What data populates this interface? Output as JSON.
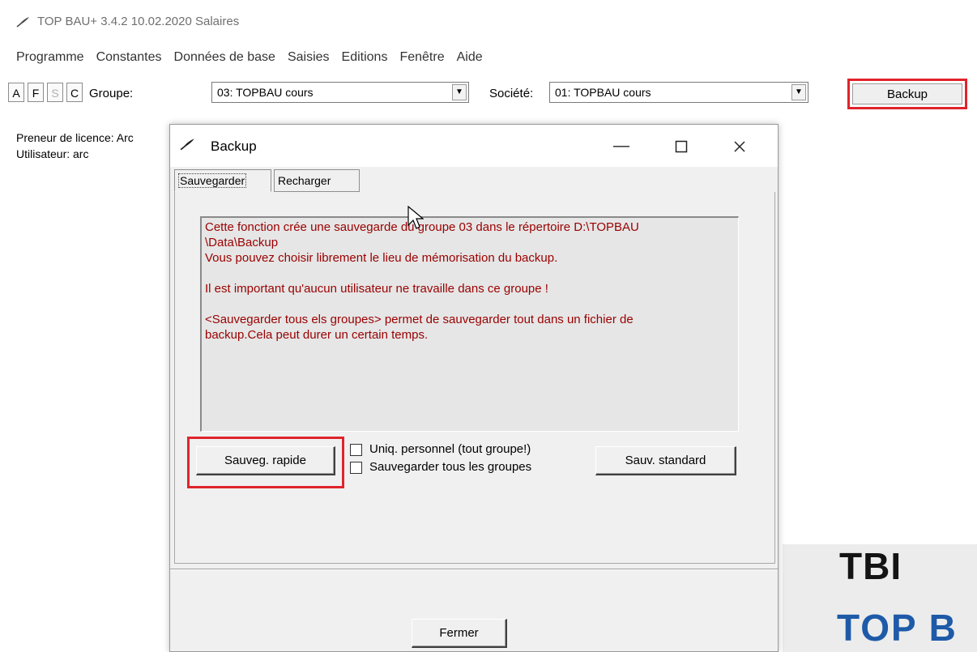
{
  "app": {
    "title": "TOP BAU+ 3.4.2  10.02.2020  Salaires"
  },
  "menu": [
    "Programme",
    "Constantes",
    "Données de base",
    "Saisies",
    "Editions",
    "Fenêtre",
    "Aide"
  ],
  "toolbar": {
    "buttons": [
      "A",
      "F",
      "S",
      "C"
    ],
    "groupe_label": "Groupe:",
    "groupe_value": "03: TOPBAU cours",
    "societe_label": "Société:",
    "societe_value": "01: TOPBAU cours",
    "backup_label": "Backup"
  },
  "info": {
    "licence": "Preneur de licence: Arc",
    "user": "Utilisateur: arc"
  },
  "logo": {
    "line1": "TBI",
    "line2": "TOP B"
  },
  "dialog": {
    "title": "Backup",
    "tabs": [
      "Sauvegarder",
      "Recharger"
    ],
    "message": "Cette fonction crée une sauvegarde du groupe 03 dans le répertoire D:\\TOPBAU\n\\Data\\Backup\nVous pouvez choisir librement le lieu de mémorisation du backup.\n\nIl est important qu'aucun utilisateur ne travaille dans ce groupe !\n\n<Sauvegarder tous els groupes> permet de sauvegarder tout dans un fichier de\nbackup.Cela peut durer un certain temps.",
    "quick_save": "Sauveg. rapide",
    "checkbox_personnel": "Uniq. personnel (tout groupe!)",
    "checkbox_all_groups": "Sauvegarder tous les groupes",
    "standard_save": "Sauv. standard",
    "close": "Fermer"
  },
  "colors": {
    "highlight": "#e0242b",
    "message_text": "#9a0000",
    "logo_blue": "#1e5aa8"
  }
}
